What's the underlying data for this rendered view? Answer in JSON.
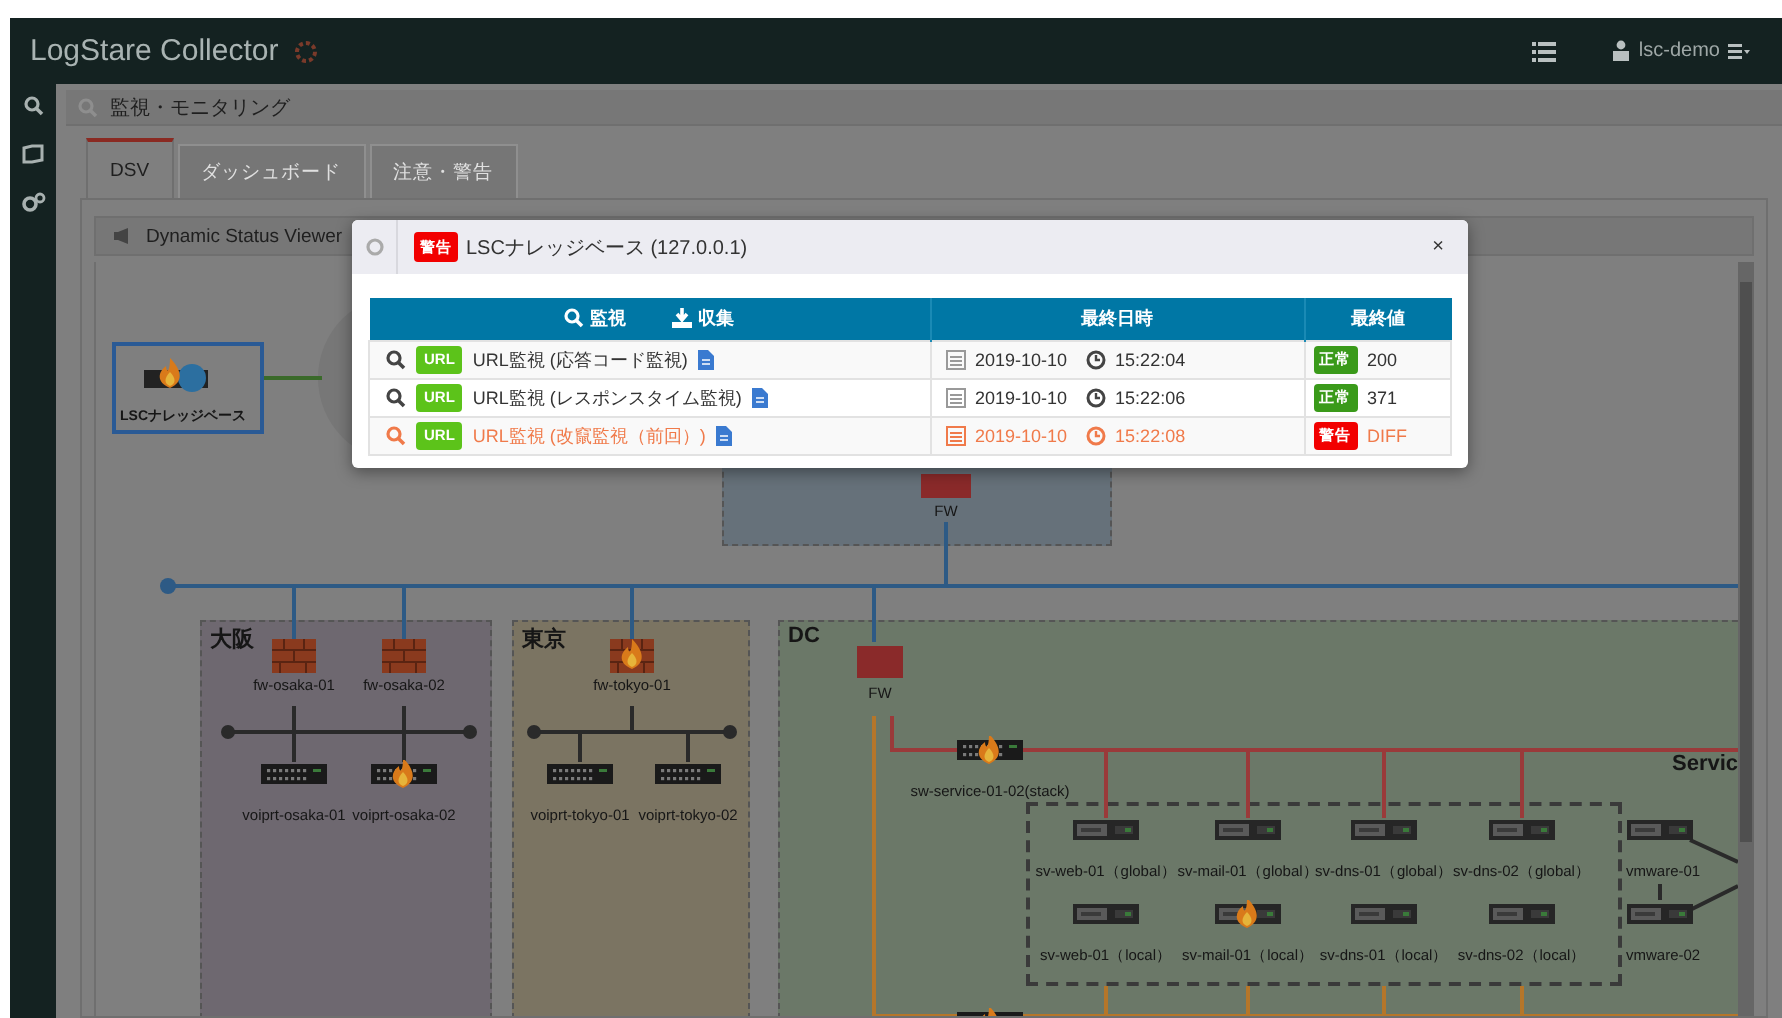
{
  "app": {
    "title": "LogStare Collector",
    "user": "lsc-demo"
  },
  "breadcrumb": "監視・モニタリング",
  "tabs": [
    {
      "label": "DSV",
      "selected": true
    },
    {
      "label": "ダッシュボード",
      "selected": false
    },
    {
      "label": "注意・警告",
      "selected": false
    }
  ],
  "panel": {
    "title": "Dynamic Status Viewer"
  },
  "diagram": {
    "source": {
      "label": "LSCナレッジベース",
      "alert": true,
      "selected": true
    },
    "core_fw": {
      "label": "FW"
    },
    "regions": [
      {
        "label": "大阪",
        "color": "#6e6870",
        "firewalls": [
          {
            "label": "fw-osaka-01",
            "alert": false
          },
          {
            "label": "fw-osaka-02",
            "alert": false
          }
        ],
        "switches": [
          {
            "label": "voiprt-osaka-01",
            "alert": false
          },
          {
            "label": "voiprt-osaka-02",
            "alert": true
          }
        ]
      },
      {
        "label": "東京",
        "color": "#7b7462",
        "firewalls": [
          {
            "label": "fw-tokyo-01",
            "alert": true
          }
        ],
        "switches": [
          {
            "label": "voiprt-tokyo-01",
            "alert": false
          },
          {
            "label": "voiprt-tokyo-02",
            "alert": false
          }
        ]
      },
      {
        "label": "DC",
        "color": "#6b7868"
      }
    ],
    "dc": {
      "fw": {
        "label": "FW"
      },
      "stack": {
        "label": "sw-service-01-02(stack)",
        "alert": true
      },
      "servers": [
        {
          "label": "sv-web-01（global）",
          "alert": false
        },
        {
          "label": "sv-mail-01（global）",
          "alert": false
        },
        {
          "label": "sv-dns-01（global）",
          "alert": false
        },
        {
          "label": "sv-dns-02（global）",
          "alert": false
        },
        {
          "label": "sv-web-01（local）",
          "alert": false
        },
        {
          "label": "sv-mail-01（local）",
          "alert": true
        },
        {
          "label": "sv-dns-01（local）",
          "alert": false
        },
        {
          "label": "sv-dns-02（local）",
          "alert": false
        }
      ],
      "vmware": [
        {
          "label": "vmware-01"
        },
        {
          "label": "vmware-02"
        }
      ],
      "zone_label": "Servic",
      "bottom_switch": {
        "alert": true
      }
    }
  },
  "modal": {
    "badge": "警告",
    "title": "LSCナレッジベース (127.0.0.1)",
    "close": "×",
    "actions": [
      "監視",
      "収集"
    ],
    "columns": [
      "最終日時",
      "最終値"
    ],
    "rows": [
      {
        "type": "URL",
        "name": "URL監視 (応答コード監視)",
        "date": "2019-10-10",
        "time": "15:22:04",
        "status": "正常",
        "value": "200",
        "alert": false
      },
      {
        "type": "URL",
        "name": "URL監視 (レスポンスタイム監視)",
        "date": "2019-10-10",
        "time": "15:22:06",
        "status": "正常",
        "value": "371",
        "alert": false
      },
      {
        "type": "URL",
        "name": "URL監視 (改竄監視（前回）)",
        "date": "2019-10-10",
        "time": "15:22:08",
        "status": "警告",
        "value": "DIFF",
        "alert": true
      }
    ]
  }
}
